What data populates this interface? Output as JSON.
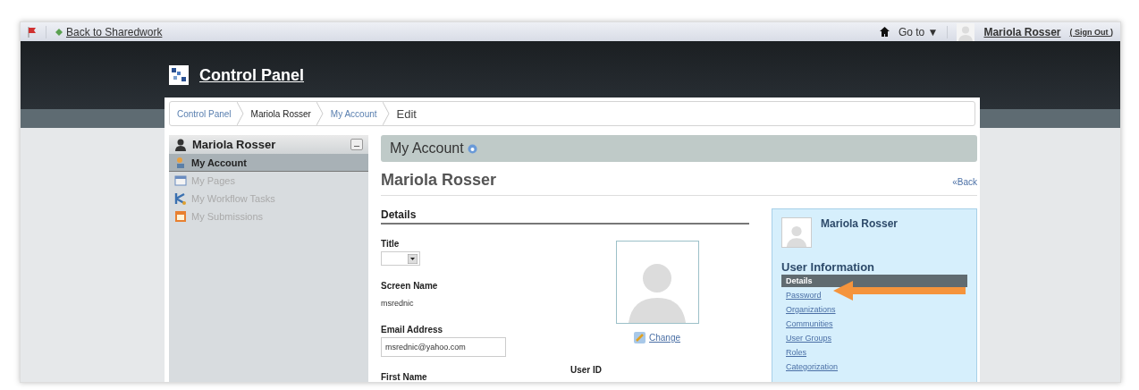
{
  "top_bar": {
    "back_link": "Back to Sharedwork",
    "goto": "Go to ▼",
    "user_name": "Mariola Rosser",
    "sign_out": "( Sign Out )"
  },
  "header": {
    "title": "Control Panel"
  },
  "breadcrumb": [
    {
      "label": "Control Panel",
      "kind": "link"
    },
    {
      "label": "Mariola Rosser",
      "kind": "text"
    },
    {
      "label": "My Account",
      "kind": "link"
    },
    {
      "label": "Edit",
      "kind": "current"
    }
  ],
  "sidebar": {
    "title": "Mariola Rosser",
    "collapse": "–",
    "items": [
      {
        "label": "My Account",
        "selected": true,
        "kind": "account"
      },
      {
        "label": "My Pages",
        "selected": false,
        "kind": "pages"
      },
      {
        "label": "My Workflow Tasks",
        "selected": false,
        "kind": "workflow"
      },
      {
        "label": "My Submissions",
        "selected": false,
        "kind": "submissions"
      }
    ]
  },
  "main": {
    "section_title": "My Account",
    "user_name": "Mariola Rosser",
    "back_link": "«Back",
    "details_heading": "Details",
    "fields": [
      {
        "label": "Title",
        "kind": "select"
      },
      {
        "label": "Screen Name",
        "kind": "text",
        "value": "msrednic"
      },
      {
        "label": "Email Address",
        "kind": "input",
        "value": "msrednic@yahoo.com"
      },
      {
        "label": "First Name",
        "kind": "label"
      }
    ],
    "change_link": "Change",
    "user_id_label": "User ID"
  },
  "user_panel": {
    "name": "Mariola Rosser",
    "heading": "User Information",
    "items": [
      {
        "label": "Details",
        "selected": true
      },
      {
        "label": "Password",
        "selected": false
      },
      {
        "label": "Organizations",
        "selected": false
      },
      {
        "label": "Communities",
        "selected": false
      },
      {
        "label": "User Groups",
        "selected": false
      },
      {
        "label": "Roles",
        "selected": false
      },
      {
        "label": "Categorization",
        "selected": false
      }
    ]
  }
}
